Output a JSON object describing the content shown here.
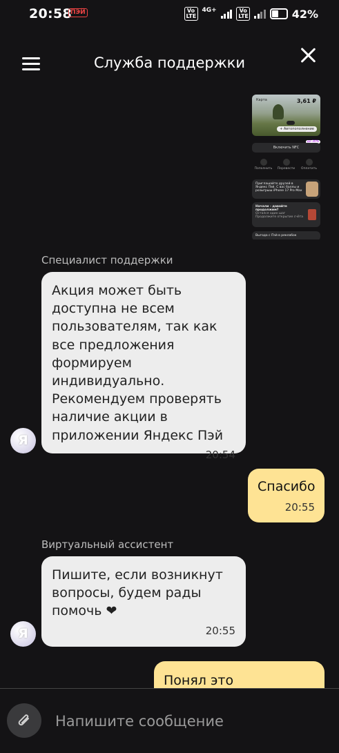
{
  "status_bar": {
    "time": "20:58",
    "sim_label": "ПЭЙ",
    "volte": "Vo LTE",
    "network": "4G+",
    "battery": "42%",
    "battery_level": 0.42
  },
  "header": {
    "title": "Служба поддержки"
  },
  "attachment": {
    "card_label": "Карта",
    "card_amount": "3,61 ₽",
    "card_chip": "+ Автопополнение",
    "nfc_label": "Включить NFC",
    "badge": "до 30%",
    "actions": [
      "Пополнить",
      "Перевести",
      "Оплатить"
    ],
    "banner1": "Приглашайте друзей в Яндекс Пэй. С вас баллы и розыгрыш iPhone 17 Pro Max",
    "banner2_title": "Начали - давайте продолжим?",
    "banner2_sub": "Остался один шаг Продолжите открытие счёта",
    "banner3": "Выгода с Пэй в реклабок"
  },
  "messages": [
    {
      "sender": "Специалист поддержки",
      "text": "Акция может быть доступна не всем пользователям, так как все предложения формируем индивидуально. Рекомендуем проверять наличие акции в приложении Яндекс Пэй",
      "time": "20:54",
      "avatar": "Я"
    },
    {
      "text": "Спасибо",
      "time": "20:55"
    },
    {
      "sender": "Виртуальный ассистент",
      "text": "Пишите, если возникнут вопросы, будем рады помочь ❤",
      "time": "20:55",
      "avatar": "Я"
    },
    {
      "text": "Понял это прискорбно"
    }
  ],
  "composer": {
    "placeholder": "Напишите сообщение"
  },
  "icons": {
    "menu": "menu-icon",
    "close": "close-icon",
    "attach": "paperclip-icon"
  },
  "colors": {
    "background": "#141315",
    "incoming_bubble": "#ededed",
    "outgoing_bubble": "#fee394"
  }
}
